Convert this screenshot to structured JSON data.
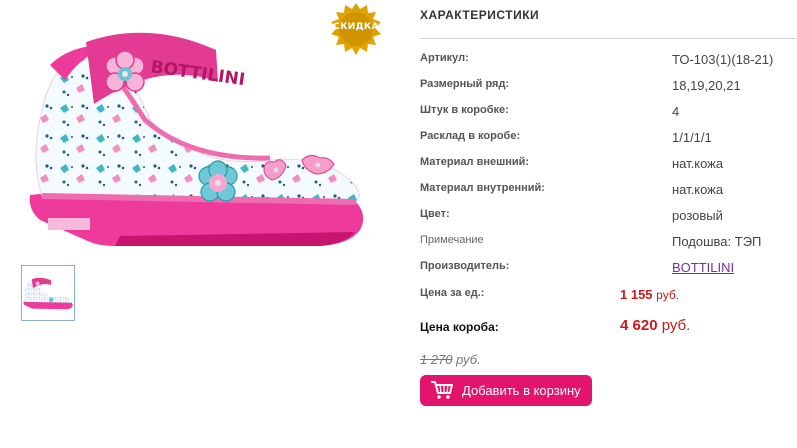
{
  "badge": {
    "text": "СКИДКА"
  },
  "product": {
    "brand_print": "BOTTILINI"
  },
  "specs": {
    "title": "ХАРАКТЕРИСТИКИ",
    "rows": [
      {
        "label": "Артикул:",
        "value": "ТО-103(1)(18-21)"
      },
      {
        "label": "Размерный ряд:",
        "value": "18,19,20,21"
      },
      {
        "label": "Штук в коробке:",
        "value": "4"
      },
      {
        "label": "Расклад в коробе:",
        "value": "1/1/1/1"
      },
      {
        "label": "Материал внешний:",
        "value": "нат.кожа"
      },
      {
        "label": "Материал внутренний:",
        "value": "нат.кожа"
      },
      {
        "label": "Цвет:",
        "value": "розовый"
      },
      {
        "label": "Примечание",
        "value": "Подошва: ТЭП"
      },
      {
        "label": "Производитель:",
        "value": "BOTTILINI"
      }
    ]
  },
  "price": {
    "unit_label": "Цена за ед.:",
    "unit_value": "1 155",
    "box_label": "Цена короба:",
    "box_value": "4 620",
    "currency_short": "руб.",
    "currency_box": "руб.",
    "old_value": "1 270",
    "old_currency": "руб."
  },
  "actions": {
    "add_to_cart": "Добавить в корзину"
  },
  "colors": {
    "accent": "#e4136b",
    "price": "#cc1a1a",
    "link": "#7b2ca0",
    "badge": "#e0a400"
  }
}
